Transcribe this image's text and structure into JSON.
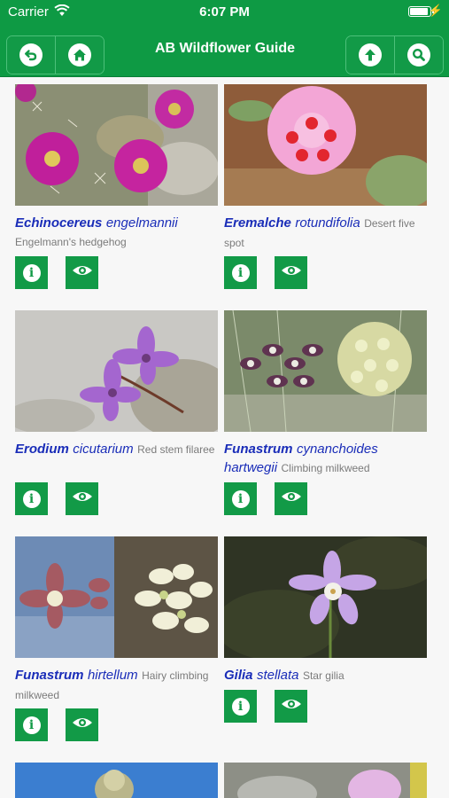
{
  "status_bar": {
    "carrier": "Carrier",
    "time": "6:07 PM"
  },
  "nav": {
    "title": "AB Wildflower Guide",
    "back_icon": "back-arrow-icon",
    "home_icon": "home-icon",
    "up_icon": "up-arrow-icon",
    "search_icon": "search-icon",
    "brand_color": "#0e9a44"
  },
  "plants": [
    {
      "genus": "Echinocereus",
      "species": "engelmannii",
      "common": "Engelmann's hedgehog"
    },
    {
      "genus": "Eremalche",
      "species": "rotundifolia",
      "common": "Desert five spot"
    },
    {
      "genus": "Erodium",
      "species": "cicutarium",
      "common": "Red stem filaree"
    },
    {
      "genus": "Funastrum",
      "species": "cynanchoides hartwegii",
      "common": "Climbing milkweed"
    },
    {
      "genus": "Funastrum",
      "species": "hirtellum",
      "common": "Hairy climbing milkweed"
    },
    {
      "genus": "Gilia",
      "species": "stellata",
      "common": "Star gilia"
    }
  ],
  "actions": {
    "info_icon": "info-icon",
    "view_icon": "eye-icon",
    "info_glyph": "i"
  }
}
